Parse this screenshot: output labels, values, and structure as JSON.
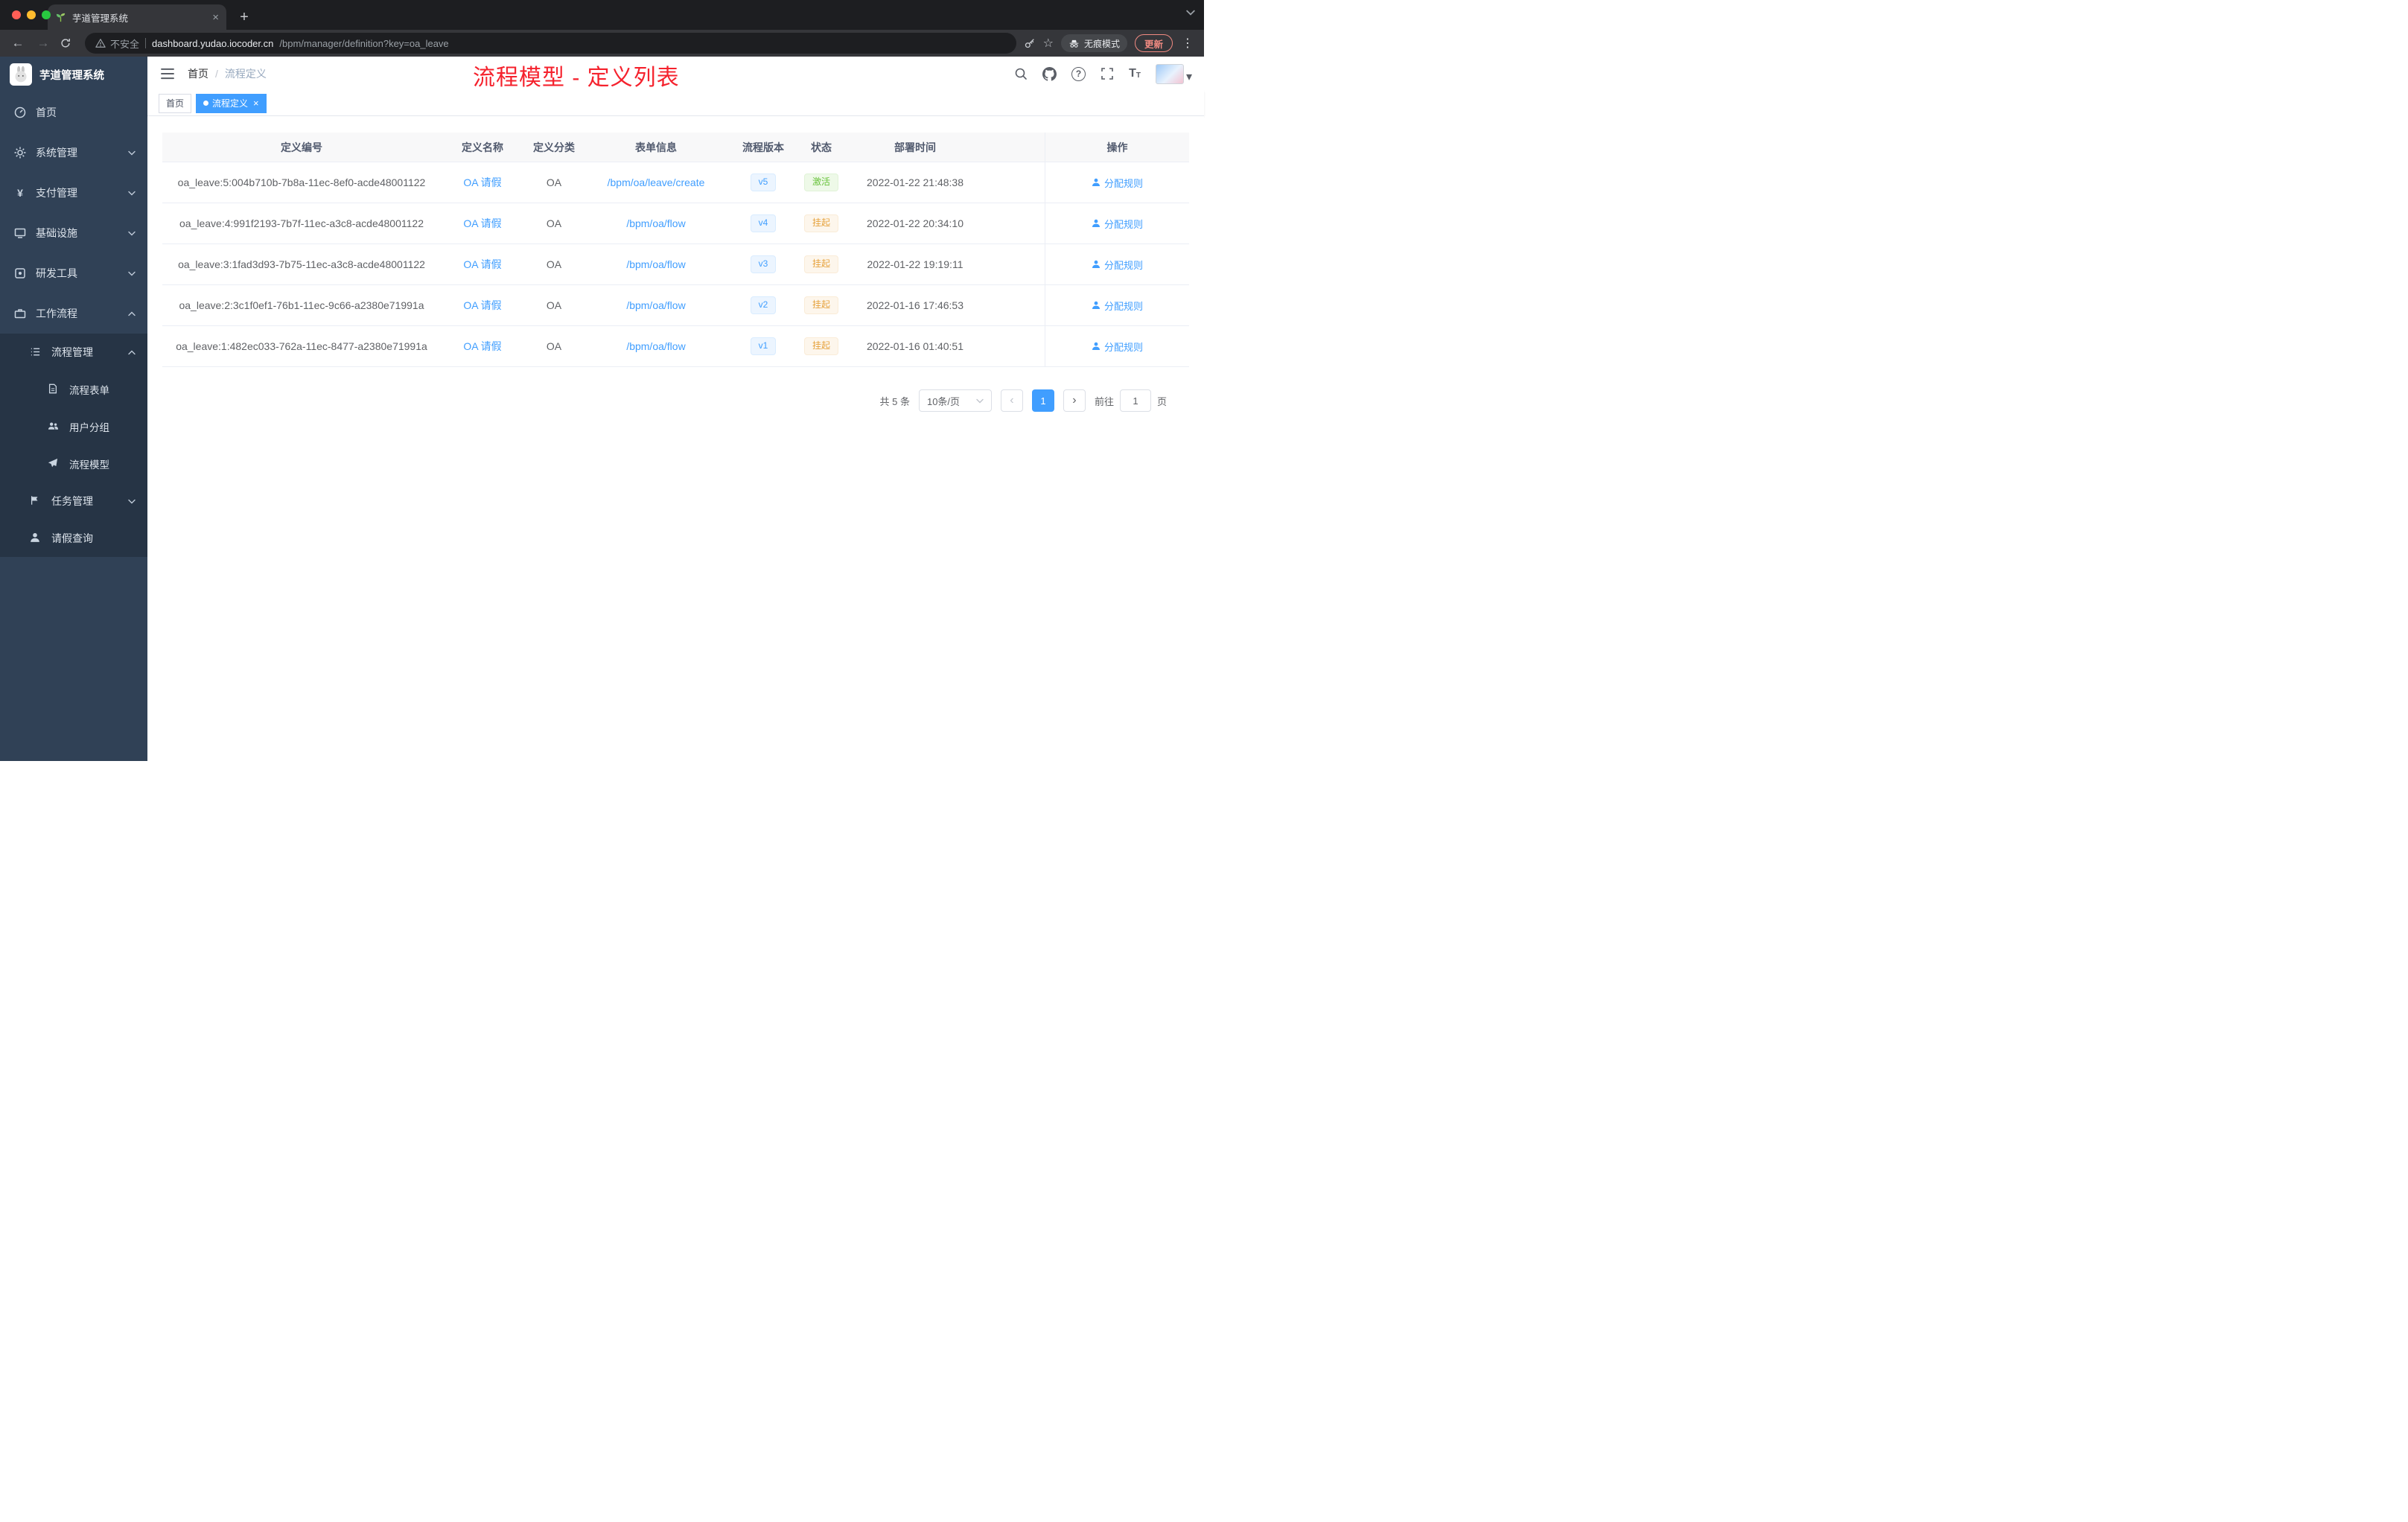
{
  "colors": {
    "accent": "#409eff",
    "annotation_red": "#f5222d",
    "status_active_green": "#67c23a",
    "status_suspended_orange": "#e6a23c",
    "sidebar_bg": "#304156",
    "submenu_bg": "#263445"
  },
  "glyphs": {
    "back": "←",
    "forward": "→",
    "close": "×",
    "plus": "+",
    "more": "⋮",
    "star": "☆",
    "prev": "‹",
    "next": "›",
    "question": "?",
    "font_big": "T",
    "font_small": "T",
    "caret": "▾"
  },
  "browser": {
    "tab": {
      "title": "芋道管理系统"
    },
    "toolbar": {
      "security": "不安全",
      "url_host": "dashboard.yudao.iocoder.cn",
      "url_path": "/bpm/manager/definition?key=oa_leave",
      "incognito": "无痕模式",
      "update": "更新"
    }
  },
  "sidebar": {
    "title": "芋道管理系统",
    "menu": [
      {
        "label": "首页"
      },
      {
        "label": "系统管理"
      },
      {
        "label": "支付管理"
      },
      {
        "label": "基础设施"
      },
      {
        "label": "研发工具"
      },
      {
        "label": "工作流程"
      },
      {
        "label": "流程管理"
      },
      {
        "label": "流程表单"
      },
      {
        "label": "用户分组"
      },
      {
        "label": "流程模型"
      },
      {
        "label": "任务管理"
      },
      {
        "label": "请假查询"
      }
    ]
  },
  "header": {
    "breadcrumb": {
      "home": "首页",
      "separator": "/",
      "current": "流程定义"
    },
    "annotation": "流程模型 - 定义列表"
  },
  "tags": {
    "home": "首页",
    "active": "流程定义"
  },
  "table": {
    "headers": [
      "定义编号",
      "定义名称",
      "定义分类",
      "表单信息",
      "流程版本",
      "状态",
      "部署时间",
      "操作"
    ],
    "action_label": "分配规则",
    "rows": [
      {
        "id": "oa_leave:5:004b710b-7b8a-11ec-8ef0-acde48001122",
        "name": "OA 请假",
        "category": "OA",
        "form": "/bpm/oa/leave/create",
        "version": "v5",
        "status": "激活",
        "time": "2022-01-22 21:48:38"
      },
      {
        "id": "oa_leave:4:991f2193-7b7f-11ec-a3c8-acde48001122",
        "name": "OA 请假",
        "category": "OA",
        "form": "/bpm/oa/flow",
        "version": "v4",
        "status": "挂起",
        "time": "2022-01-22 20:34:10"
      },
      {
        "id": "oa_leave:3:1fad3d93-7b75-11ec-a3c8-acde48001122",
        "name": "OA 请假",
        "category": "OA",
        "form": "/bpm/oa/flow",
        "version": "v3",
        "status": "挂起",
        "time": "2022-01-22 19:19:11"
      },
      {
        "id": "oa_leave:2:3c1f0ef1-76b1-11ec-9c66-a2380e71991a",
        "name": "OA 请假",
        "category": "OA",
        "form": "/bpm/oa/flow",
        "version": "v2",
        "status": "挂起",
        "time": "2022-01-16 17:46:53"
      },
      {
        "id": "oa_leave:1:482ec033-762a-11ec-8477-a2380e71991a",
        "name": "OA 请假",
        "category": "OA",
        "form": "/bpm/oa/flow",
        "version": "v1",
        "status": "挂起",
        "time": "2022-01-16 01:40:51"
      }
    ]
  },
  "pagination": {
    "total": "共 5 条",
    "page_size": "10条/页",
    "current": "1",
    "goto_prefix": "前往",
    "goto_value": "1",
    "goto_suffix": "页"
  }
}
